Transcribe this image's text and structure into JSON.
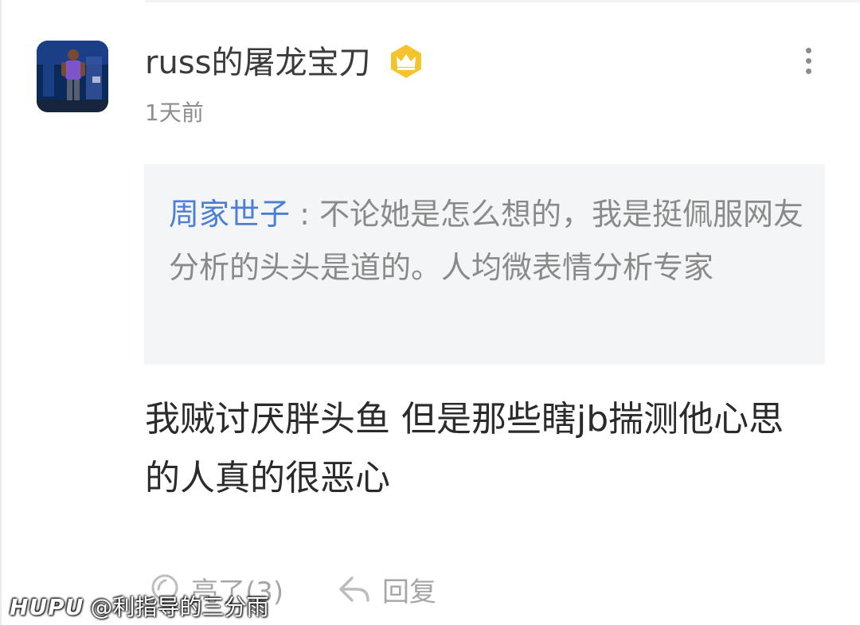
{
  "comment": {
    "username": "russ的屠龙宝刀",
    "timestamp": "1天前",
    "badge_icon": "crown-badge-icon",
    "quote": {
      "author": "周家世子",
      "separator": " : ",
      "text": "不论她是怎么想的，我是挺佩服网友分析的头头是道的。人均微表情分析专家"
    },
    "body": "我贼讨厌胖头鱼 但是那些瞎jb揣测他心思的人真的很恶心",
    "actions": {
      "light_label": "亮了(3)",
      "reply_label": "回复"
    }
  },
  "watermark": {
    "brand": "HUPU",
    "handle": "@利指导的三分雨"
  },
  "colors": {
    "author_link": "#4a7fd4",
    "badge": "#f5c32c",
    "quote_bg": "#f4f5f6",
    "muted_text": "#8d8d8d"
  }
}
